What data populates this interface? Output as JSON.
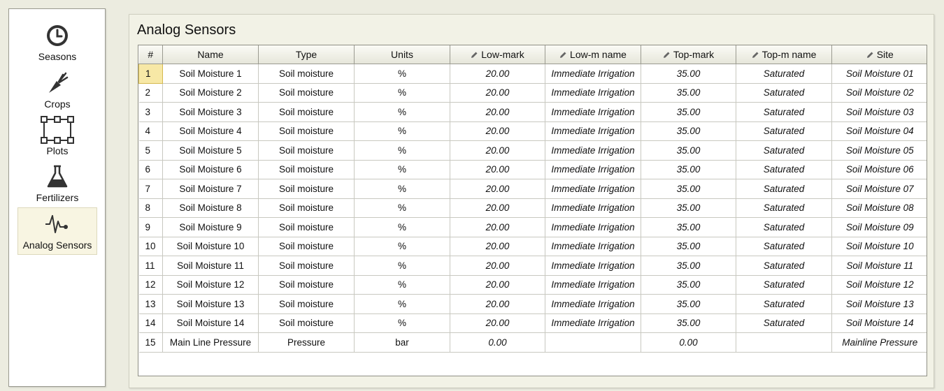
{
  "sidebar": {
    "items": [
      {
        "label": "Seasons",
        "icon": "clock-icon"
      },
      {
        "label": "Crops",
        "icon": "carrot-icon"
      },
      {
        "label": "Plots",
        "icon": "plot-frame-icon"
      },
      {
        "label": "Fertilizers",
        "icon": "flask-icon"
      },
      {
        "label": "Analog Sensors",
        "icon": "pulse-icon",
        "active": true
      }
    ]
  },
  "main": {
    "title": "Analog Sensors",
    "columns": [
      "#",
      "Name",
      "Type",
      "Units",
      "Low-mark",
      "Low-m name",
      "Top-mark",
      "Top-m name",
      "Site"
    ],
    "editable_columns": [
      "Low-mark",
      "Low-m name",
      "Top-mark",
      "Top-m name",
      "Site"
    ],
    "selected_row": 1,
    "rows": [
      [
        "1",
        "Soil Moisture 1",
        "Soil moisture",
        "%",
        "20.00",
        "Immediate Irrigation",
        "35.00",
        "Saturated",
        "Soil Moisture 01"
      ],
      [
        "2",
        "Soil Moisture 2",
        "Soil moisture",
        "%",
        "20.00",
        "Immediate Irrigation",
        "35.00",
        "Saturated",
        "Soil Moisture 02"
      ],
      [
        "3",
        "Soil Moisture 3",
        "Soil moisture",
        "%",
        "20.00",
        "Immediate Irrigation",
        "35.00",
        "Saturated",
        "Soil Moisture 03"
      ],
      [
        "4",
        "Soil Moisture 4",
        "Soil moisture",
        "%",
        "20.00",
        "Immediate Irrigation",
        "35.00",
        "Saturated",
        "Soil Moisture 04"
      ],
      [
        "5",
        "Soil Moisture 5",
        "Soil moisture",
        "%",
        "20.00",
        "Immediate Irrigation",
        "35.00",
        "Saturated",
        "Soil Moisture 05"
      ],
      [
        "6",
        "Soil Moisture 6",
        "Soil moisture",
        "%",
        "20.00",
        "Immediate Irrigation",
        "35.00",
        "Saturated",
        "Soil Moisture 06"
      ],
      [
        "7",
        "Soil Moisture 7",
        "Soil moisture",
        "%",
        "20.00",
        "Immediate Irrigation",
        "35.00",
        "Saturated",
        "Soil Moisture 07"
      ],
      [
        "8",
        "Soil Moisture 8",
        "Soil moisture",
        "%",
        "20.00",
        "Immediate Irrigation",
        "35.00",
        "Saturated",
        "Soil Moisture 08"
      ],
      [
        "9",
        "Soil Moisture 9",
        "Soil moisture",
        "%",
        "20.00",
        "Immediate Irrigation",
        "35.00",
        "Saturated",
        "Soil Moisture 09"
      ],
      [
        "10",
        "Soil Moisture 10",
        "Soil moisture",
        "%",
        "20.00",
        "Immediate Irrigation",
        "35.00",
        "Saturated",
        "Soil Moisture 10"
      ],
      [
        "11",
        "Soil Moisture 11",
        "Soil moisture",
        "%",
        "20.00",
        "Immediate Irrigation",
        "35.00",
        "Saturated",
        "Soil Moisture 11"
      ],
      [
        "12",
        "Soil Moisture 12",
        "Soil moisture",
        "%",
        "20.00",
        "Immediate Irrigation",
        "35.00",
        "Saturated",
        "Soil Moisture 12"
      ],
      [
        "13",
        "Soil Moisture 13",
        "Soil moisture",
        "%",
        "20.00",
        "Immediate Irrigation",
        "35.00",
        "Saturated",
        "Soil Moisture 13"
      ],
      [
        "14",
        "Soil Moisture 14",
        "Soil moisture",
        "%",
        "20.00",
        "Immediate Irrigation",
        "35.00",
        "Saturated",
        "Soil Moisture 14"
      ],
      [
        "15",
        "Main Line Pressure",
        "Pressure",
        "bar",
        "0.00",
        "",
        "0.00",
        "",
        "Mainline Pressure"
      ]
    ]
  },
  "colors": {
    "background": "#ecece0",
    "selection": "#f7e8a6",
    "active_nav": "#f8f5e2"
  }
}
